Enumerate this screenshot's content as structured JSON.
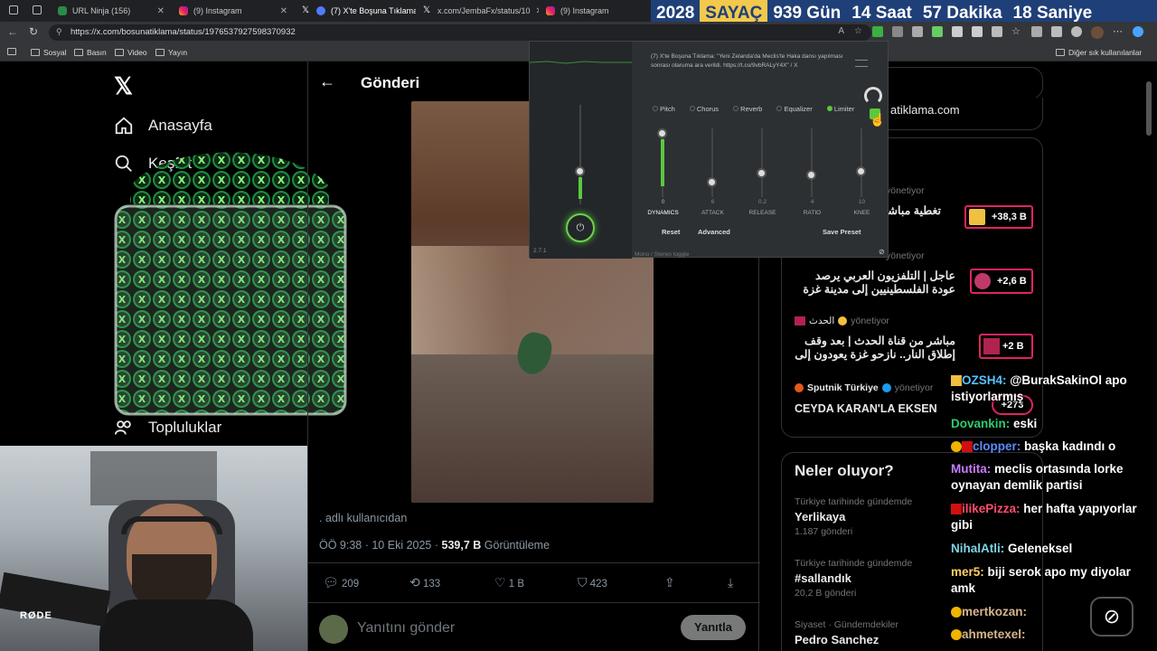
{
  "browser": {
    "tabs": [
      {
        "title": "URL Ninja (156)",
        "active": false
      },
      {
        "title": "(9) Instagram",
        "active": false
      },
      {
        "title": "(7) X'te Boşuna Tıklama",
        "active": true
      },
      {
        "title": "x.com/JembaFx/status/10",
        "active": false
      },
      {
        "title": "(9) Instagram",
        "active": false
      }
    ],
    "url": "https://x.com/bosunatiklama/status/1976537927598370932",
    "bookmarks": [
      "Sosyal",
      "Basın",
      "Video",
      "Yayın"
    ],
    "other_bookmarks": "Diğer sık kullanılanlar"
  },
  "countdown": {
    "year": "2028",
    "label": "SAYAÇ",
    "days": "939 Gün",
    "hours": "14 Saat",
    "minutes": "57 Dakika",
    "seconds": "18 Saniye"
  },
  "nav": {
    "home": "Anasayfa",
    "explore": "Keşfet",
    "communities": "Topluluklar"
  },
  "post": {
    "header": "Gönderi",
    "translated_note": ". adlı kullanıcıdan",
    "time": "ÖÖ 9:38 · 10 Eki 2025 · ",
    "views_count": "539,7 B",
    "views_label": "Görüntüleme",
    "replies": "209",
    "reposts": "133",
    "likes": "1 B",
    "bookmarks": "423",
    "reply_placeholder": "Yanıtını gönder",
    "reply_button": "Yanıtla"
  },
  "right": {
    "search_domain": "atiklama.com",
    "trending_title": "Neler oluyor?",
    "live_items": [
      {
        "title": "تغطية مباشر تبدأ الانسحا",
        "count": "+38,3 B",
        "color": "#f0c040"
      },
      {
        "account": "",
        "status": "yönetiyor",
        "title": "عاجل | التلفزيون العربي يرصد عودة الفلسطينيين إلى مدينة غزة",
        "count": "+2,6 B",
        "color": "#c0396b"
      },
      {
        "account": "الحدث",
        "status": "yönetiyor",
        "title": "مباشر من قناة الحدث | بعد وقف إطلاق النار.. نازحو غزة يعودون إلى",
        "count": "+2 B",
        "color": "#b0234f"
      },
      {
        "account": "Sputnik Türkiye",
        "status": "yönetiyor",
        "title": "CEYDA KARAN'LA EKSEN",
        "count": "+273",
        "color": "#e05a1a"
      }
    ],
    "live_top_status": "yönetiyor",
    "live_second_status": "yönetiyor",
    "trends": [
      {
        "context": "Türkiye tarihinde gündemde",
        "name": "Yerlikaya",
        "posts": "1.187 gönderi"
      },
      {
        "context": "Türkiye tarihinde gündemde",
        "name": "#sallandık",
        "posts": "20,2 B gönderi"
      },
      {
        "context": "Siyaset · Gündemdekiler",
        "name": "Pedro Sanchez",
        "posts": ""
      }
    ]
  },
  "plugin": {
    "tabs": [
      "Pitch",
      "Chorus",
      "Reverb",
      "Equalizer",
      "Limiter"
    ],
    "active_tab": "Limiter",
    "notification": "(7) X'te Boşuna Tıklama: \"Yeni Zelanda'da Meclis'te Haka dansı yapılması sonrası olaruma ara verildi. https://t.co/9vbRALyY4X\" / X",
    "sliders": [
      {
        "label": "DYNAMICS",
        "value": "0",
        "level": 0.85
      },
      {
        "label": "ATTACK",
        "value": "6",
        "level": 0.25
      },
      {
        "label": "RELEASE",
        "value": "0.2",
        "level": 0.35
      },
      {
        "label": "RATIO",
        "value": "4",
        "level": 0.3
      },
      {
        "label": "KNEE",
        "value": "10",
        "level": 0.4
      }
    ],
    "reset": "Reset",
    "advanced": "Advanced",
    "save_preset": "Save Preset",
    "version": "2.7.1",
    "footer": "Mono / Stereo toggle"
  },
  "chat": [
    {
      "user": "OZSH4:",
      "user_color": "#5bc0ff",
      "msg": " @BurakSakinOl apo istiyorlarmış"
    },
    {
      "user": "Dovankin:",
      "user_color": "#2ecc71",
      "msg": " eski"
    },
    {
      "user": "clopper:",
      "user_color": "#5b8cff",
      "msg": " başka kadındı o"
    },
    {
      "user": "Mutita:",
      "user_color": "#c77dff",
      "msg": " meclis ortasında lorke oynayan demlik partisi"
    },
    {
      "user": "ilikePizza:",
      "user_color": "#ff4d6d",
      "msg": " her hafta yapıyorlar gibi"
    },
    {
      "user": "NihalAtli:",
      "user_color": "#7fd3e6",
      "msg": " Geleneksel"
    },
    {
      "user": "mer5:",
      "user_color": "#ffd166",
      "msg": " biji serok apo my diyolar amk"
    },
    {
      "user": "mertkozan:",
      "user_color": "#d6b48a",
      "msg": ""
    },
    {
      "user": "ahmetexel:",
      "user_color": "#d6b48a",
      "msg": ""
    }
  ],
  "webcam": {
    "mic_brand": "RØDE"
  }
}
